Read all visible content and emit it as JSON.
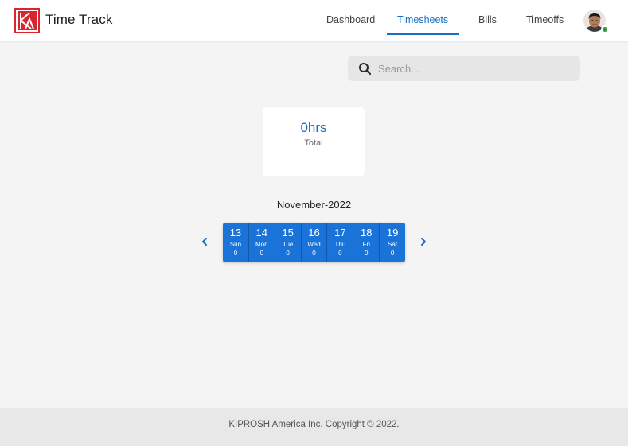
{
  "header": {
    "app_title": "Time Track",
    "nav": [
      {
        "label": "Dashboard",
        "active": false
      },
      {
        "label": "Timesheets",
        "active": true
      },
      {
        "label": "Bills",
        "active": false
      },
      {
        "label": "Timeoffs",
        "active": false
      }
    ],
    "user_status": "online"
  },
  "search": {
    "placeholder": "Search...",
    "value": ""
  },
  "summary": {
    "total_value": "0hrs",
    "total_label": "Total"
  },
  "calendar": {
    "month_label": "November-2022",
    "days": [
      {
        "date": "13",
        "weekday": "Sun",
        "hours": "0"
      },
      {
        "date": "14",
        "weekday": "Mon",
        "hours": "0"
      },
      {
        "date": "15",
        "weekday": "Tue",
        "hours": "0"
      },
      {
        "date": "16",
        "weekday": "Wed",
        "hours": "0"
      },
      {
        "date": "17",
        "weekday": "Thu",
        "hours": "0"
      },
      {
        "date": "18",
        "weekday": "Fri",
        "hours": "0"
      },
      {
        "date": "19",
        "weekday": "Sat",
        "hours": "0"
      }
    ]
  },
  "footer": {
    "copyright": "KIPROSH America Inc. Copyright © 2022."
  },
  "colors": {
    "accent": "#1b6fc2",
    "day_strip": "#1a73d9",
    "logo_red": "#d9262e",
    "status_online": "#2e9a3e"
  },
  "icons": {
    "logo": "kiprosh-logo",
    "search": "search-icon",
    "prev": "chevron-left-icon",
    "next": "chevron-right-icon"
  }
}
